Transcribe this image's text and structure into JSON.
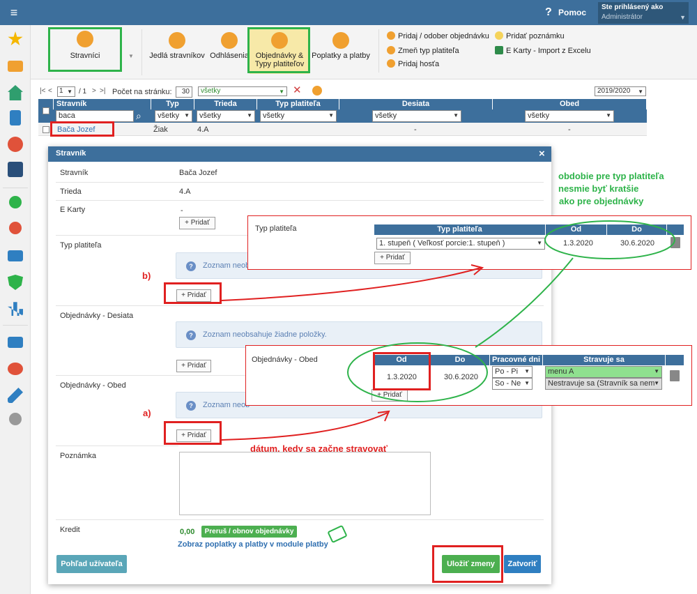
{
  "topbar": {
    "help": "Pomoc",
    "user_line1": "Ste prihlásený ako",
    "user_line2": "Administrátor"
  },
  "toolbar": {
    "stravnici": "Stravníci",
    "jedla": "Jedlá stravníkov",
    "odhlasenia": "Odhlásenia",
    "objednavky_l1": "Objednávky &",
    "objednavky_l2": "Typy platiteľov",
    "poplatky": "Poplatky a platby",
    "actions": [
      "Pridaj / odober objednávku",
      "Zmeň typ platiteľa",
      "Pridaj hosťa",
      "Pridať poznámku",
      "E Karty - Import z Excelu"
    ]
  },
  "pager": {
    "first": "|<",
    "prev": "<",
    "page": "1",
    "of": "/ 1",
    "next": ">",
    "last": ">|",
    "per_page_label": "Počet na stránku:",
    "per_page": "30",
    "filter": "všetky",
    "year": "2019/2020"
  },
  "table": {
    "headers": [
      "Stravník",
      "Typ",
      "Trieda",
      "Typ platiteľa",
      "Desiata",
      "Obed"
    ],
    "filters": {
      "name": "baca",
      "typ": "všetky",
      "trieda": "všetky",
      "platitel": "všetky",
      "desiata": "všetky",
      "obed": "všetky"
    },
    "row": {
      "name": "Bača Jozef",
      "typ": "Žiak",
      "trieda": "4.A",
      "platitel": "",
      "desiata": "-",
      "obed": "-"
    }
  },
  "dialog": {
    "title": "Stravník",
    "close": "×",
    "fields": {
      "stravnik_label": "Stravník",
      "stravnik_value": "Bača Jozef",
      "trieda_label": "Trieda",
      "trieda_value": "4.A",
      "ekarty_label": "E Karty",
      "ekarty_value": "-",
      "typ_label": "Typ platiteľa",
      "desiata_label": "Objednávky - Desiata",
      "obed_label": "Objednávky - Obed",
      "poznamka_label": "Poznámka",
      "kredit_label": "Kredit",
      "kredit_value": "0,00"
    },
    "add": "+ Pridať",
    "empty": "Zoznam neobsahuje žiadne položky.",
    "empty_trunc": "Zoznam neob",
    "kredit_btn": "Preruš / obnov objednávky",
    "payments_link": "Zobraz poplatky a platby v module platby",
    "view_btn": "Pohľad užívateľa",
    "save_btn": "Uložiť zmeny",
    "close_btn": "Zatvoriť"
  },
  "popup_typ": {
    "label": "Typ platiteľa",
    "headers": [
      "Typ platiteľa",
      "Od",
      "Do"
    ],
    "select": "1. stupeň ( Veľkosť porcie:1. stupeň )",
    "od": "1.3.2020",
    "do": "30.6.2020",
    "add": "+ Pridať"
  },
  "popup_obed": {
    "label": "Objednávky - Obed",
    "headers": [
      "Od",
      "Do",
      "Pracovné dni",
      "Stravuje sa"
    ],
    "od": "1.3.2020",
    "do": "30.6.2020",
    "day1": "Po - Pi",
    "day2": "So - Ne",
    "menu1": "menu A",
    "menu2": "Nestravuje sa (Stravník sa nem",
    "add": "+ Pridať"
  },
  "annotations": {
    "green1": "obdobie pre typ platiteľa",
    "green2": "nesmie byť kratšie",
    "green3": "ako pre objednávky",
    "b": "b)",
    "a": "a)",
    "red_text": "dátum, kedy sa začne stravovať"
  },
  "colors": {
    "header": "#3d6f9c",
    "red": "#e02020",
    "green": "#2eb34a",
    "kredit_btn": "#4caf50"
  }
}
